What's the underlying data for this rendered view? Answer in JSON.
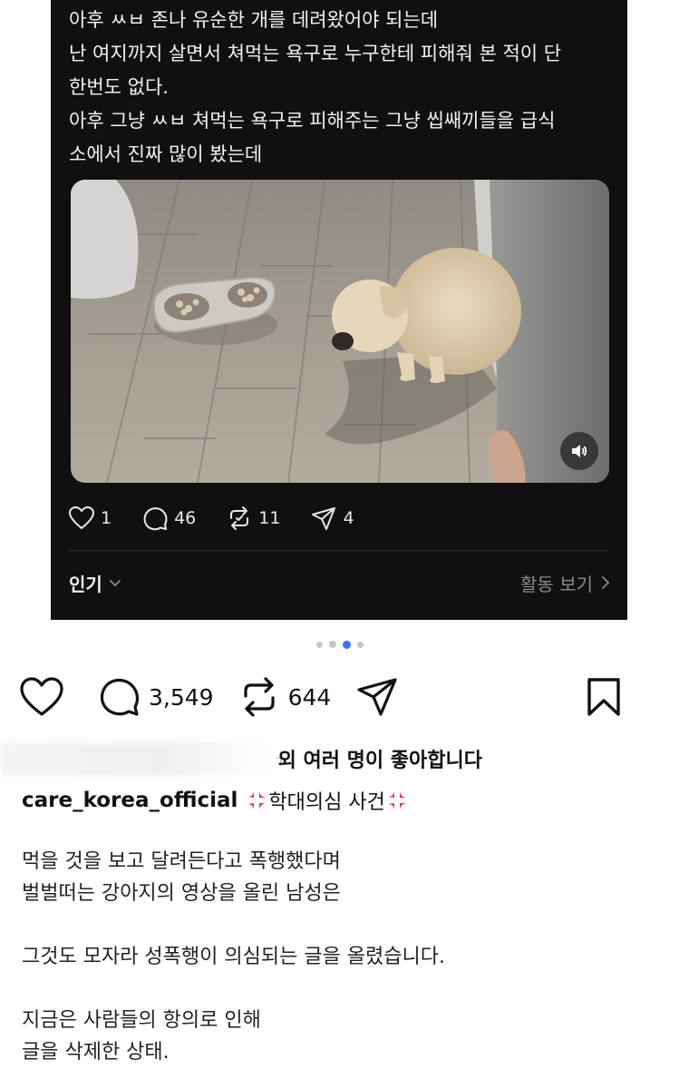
{
  "embedded_post": {
    "text_lines": [
      "아후 ㅆㅂ 존나 유순한 개를 데려왔어야 되는데",
      "난 여지까지 살면서 쳐먹는 욕구로 누구한테 피해줘 본 적이 단",
      "한번도 없다.",
      "아후 그냥 ㅆㅂ 쳐먹는 욕구로 피해주는 그냥 씹쌔끼들을 급식",
      "소에서 진짜 많이 봤는데"
    ],
    "likes": "1",
    "replies": "46",
    "reposts": "11",
    "shares": "4",
    "sort_label": "인기",
    "activity_label": "활동 보기"
  },
  "post": {
    "carousel": {
      "count": 4,
      "active_index": 2
    },
    "comment_count": "3,549",
    "repost_count": "644",
    "likes_suffix": "외 여러 명이 좋아합니다",
    "likes_faint": "ㅓ",
    "username": "care_korea_official",
    "caption_title": "학대의심 사건",
    "caption_lines": [
      "먹을 것을 보고 달려든다고  폭행했다며",
      "벌벌떠는 강아지의 영상을 올린 남성은",
      "",
      "그것도 모자라 성폭행이 의심되는 글을 올렸습니다.",
      "",
      "지금은 사람들의 항의로 인해",
      "글을 삭제한 상태."
    ]
  },
  "icons": {
    "heart": "heart-icon",
    "comment": "comment-icon",
    "repost": "repost-icon",
    "send": "send-icon",
    "bookmark": "bookmark-icon",
    "anger": "anger-symbol-emoji",
    "volume": "volume-icon",
    "chevron_down": "chevron-down-icon",
    "chevron_right": "chevron-right-icon"
  },
  "colors": {
    "embed_background": "#101010",
    "active_dot": "#3b6ef5",
    "anger_emoji": "#e8374a"
  }
}
